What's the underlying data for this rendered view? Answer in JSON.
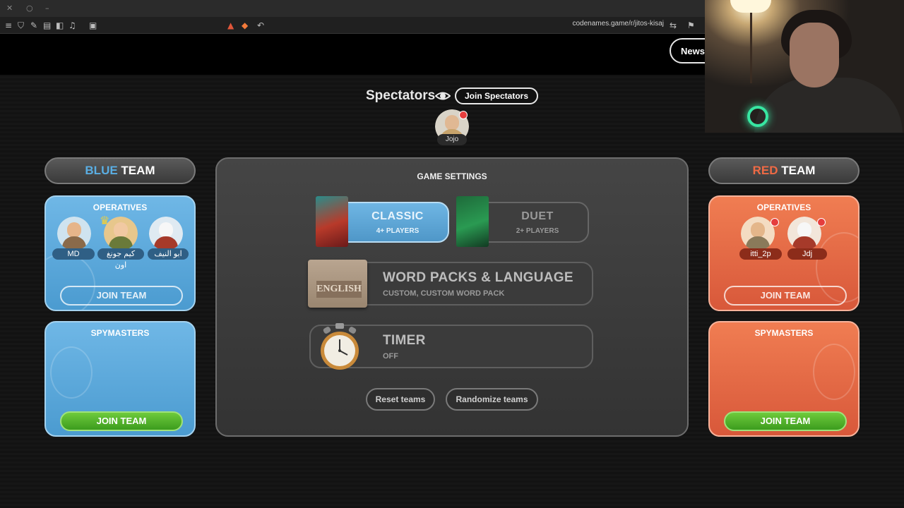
{
  "browser": {
    "url": "codenames.game/r/jitos-kisaj",
    "titlebar_controls": [
      "✕",
      "○",
      "–"
    ],
    "toolbar_icons": [
      "menu-icon",
      "shield-icon",
      "pin-icon",
      "tabs-icon",
      "sidebar-icon",
      "music-icon",
      "screenshot-icon",
      "brave-icon",
      "lion-icon",
      "back-icon",
      "translate-icon",
      "bookmark-icon"
    ]
  },
  "header": {
    "news_label": "News"
  },
  "spectators": {
    "title": "Spectators",
    "join_label": "Join Spectators",
    "members": [
      {
        "name": "Jojo"
      }
    ]
  },
  "blue_team": {
    "title_word": "BLUE",
    "title_rest": " TEAM",
    "color": "#5aaee3",
    "operatives_label": "OPERATIVES",
    "operatives": [
      {
        "name": "MD"
      },
      {
        "name": "كيم جونغ اون"
      },
      {
        "name": "ابو النيف"
      }
    ],
    "operatives_join": "JOIN TEAM",
    "spymasters_label": "SPYMASTERS",
    "spymasters_join": "JOIN TEAM"
  },
  "red_team": {
    "title_word": "RED",
    "title_rest": " TEAM",
    "color": "#ef6a45",
    "operatives_label": "OPERATIVES",
    "operatives": [
      {
        "name": "itti_2p"
      },
      {
        "name": "Jdj"
      }
    ],
    "operatives_join": "JOIN TEAM",
    "spymasters_label": "SPYMASTERS",
    "spymasters_join": "JOIN TEAM"
  },
  "settings": {
    "title": "GAME SETTINGS",
    "modes": [
      {
        "title": "CLASSIC",
        "sub": "4+ PLAYERS",
        "active": true
      },
      {
        "title": "DUET",
        "sub": "2+ PLAYERS",
        "active": false
      }
    ],
    "word_packs": {
      "title": "WORD PACKS & LANGUAGE",
      "sub": "CUSTOM, CUSTOM WORD PACK",
      "box_label": "ENGLISH"
    },
    "timer": {
      "title": "TIMER",
      "sub": "OFF"
    },
    "reset_label": "Reset teams",
    "randomize_label": "Randomize teams"
  }
}
